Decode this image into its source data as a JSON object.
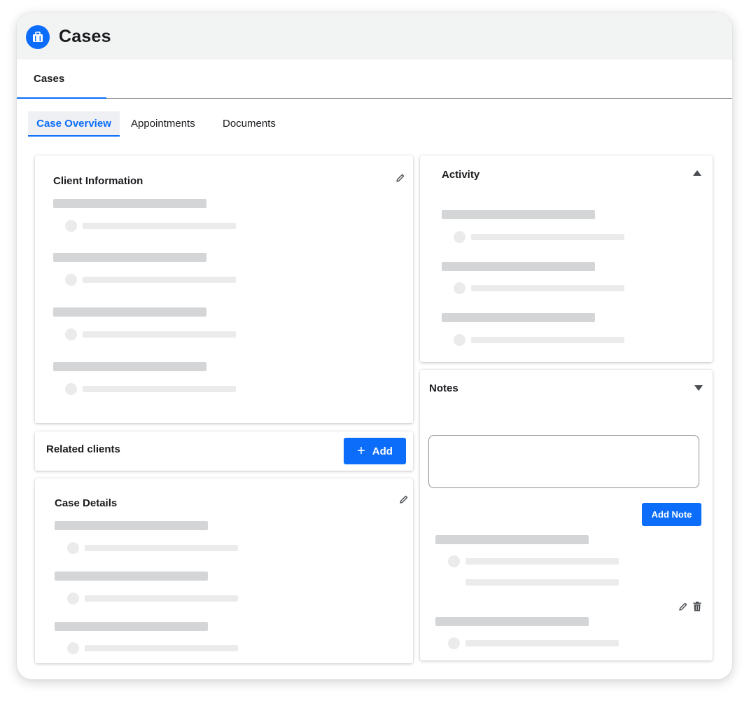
{
  "app": {
    "title": "Cases",
    "logo_icon": "briefcase-icon",
    "accent_color": "#0b6dfa"
  },
  "top_tabs": [
    {
      "label": "Cases",
      "active": true
    }
  ],
  "sub_tabs": [
    {
      "label": "Case Overview",
      "active": true
    },
    {
      "label": "Appointments",
      "active": false
    },
    {
      "label": "Documents",
      "active": false
    }
  ],
  "client_information": {
    "title": "Client Information",
    "edit_icon": "pencil-icon"
  },
  "related_clients": {
    "title": "Related clients",
    "add_button": "Add",
    "add_icon": "plus-icon"
  },
  "case_details": {
    "title": "Case Details",
    "edit_icon": "pencil-icon"
  },
  "activity": {
    "title": "Activity",
    "toggle_icon": "caret-up-icon"
  },
  "notes": {
    "title": "Notes",
    "toggle_icon": "caret-down-icon",
    "add_note_button": "Add Note",
    "edit_icon": "pencil-icon",
    "delete_icon": "trash-icon"
  }
}
